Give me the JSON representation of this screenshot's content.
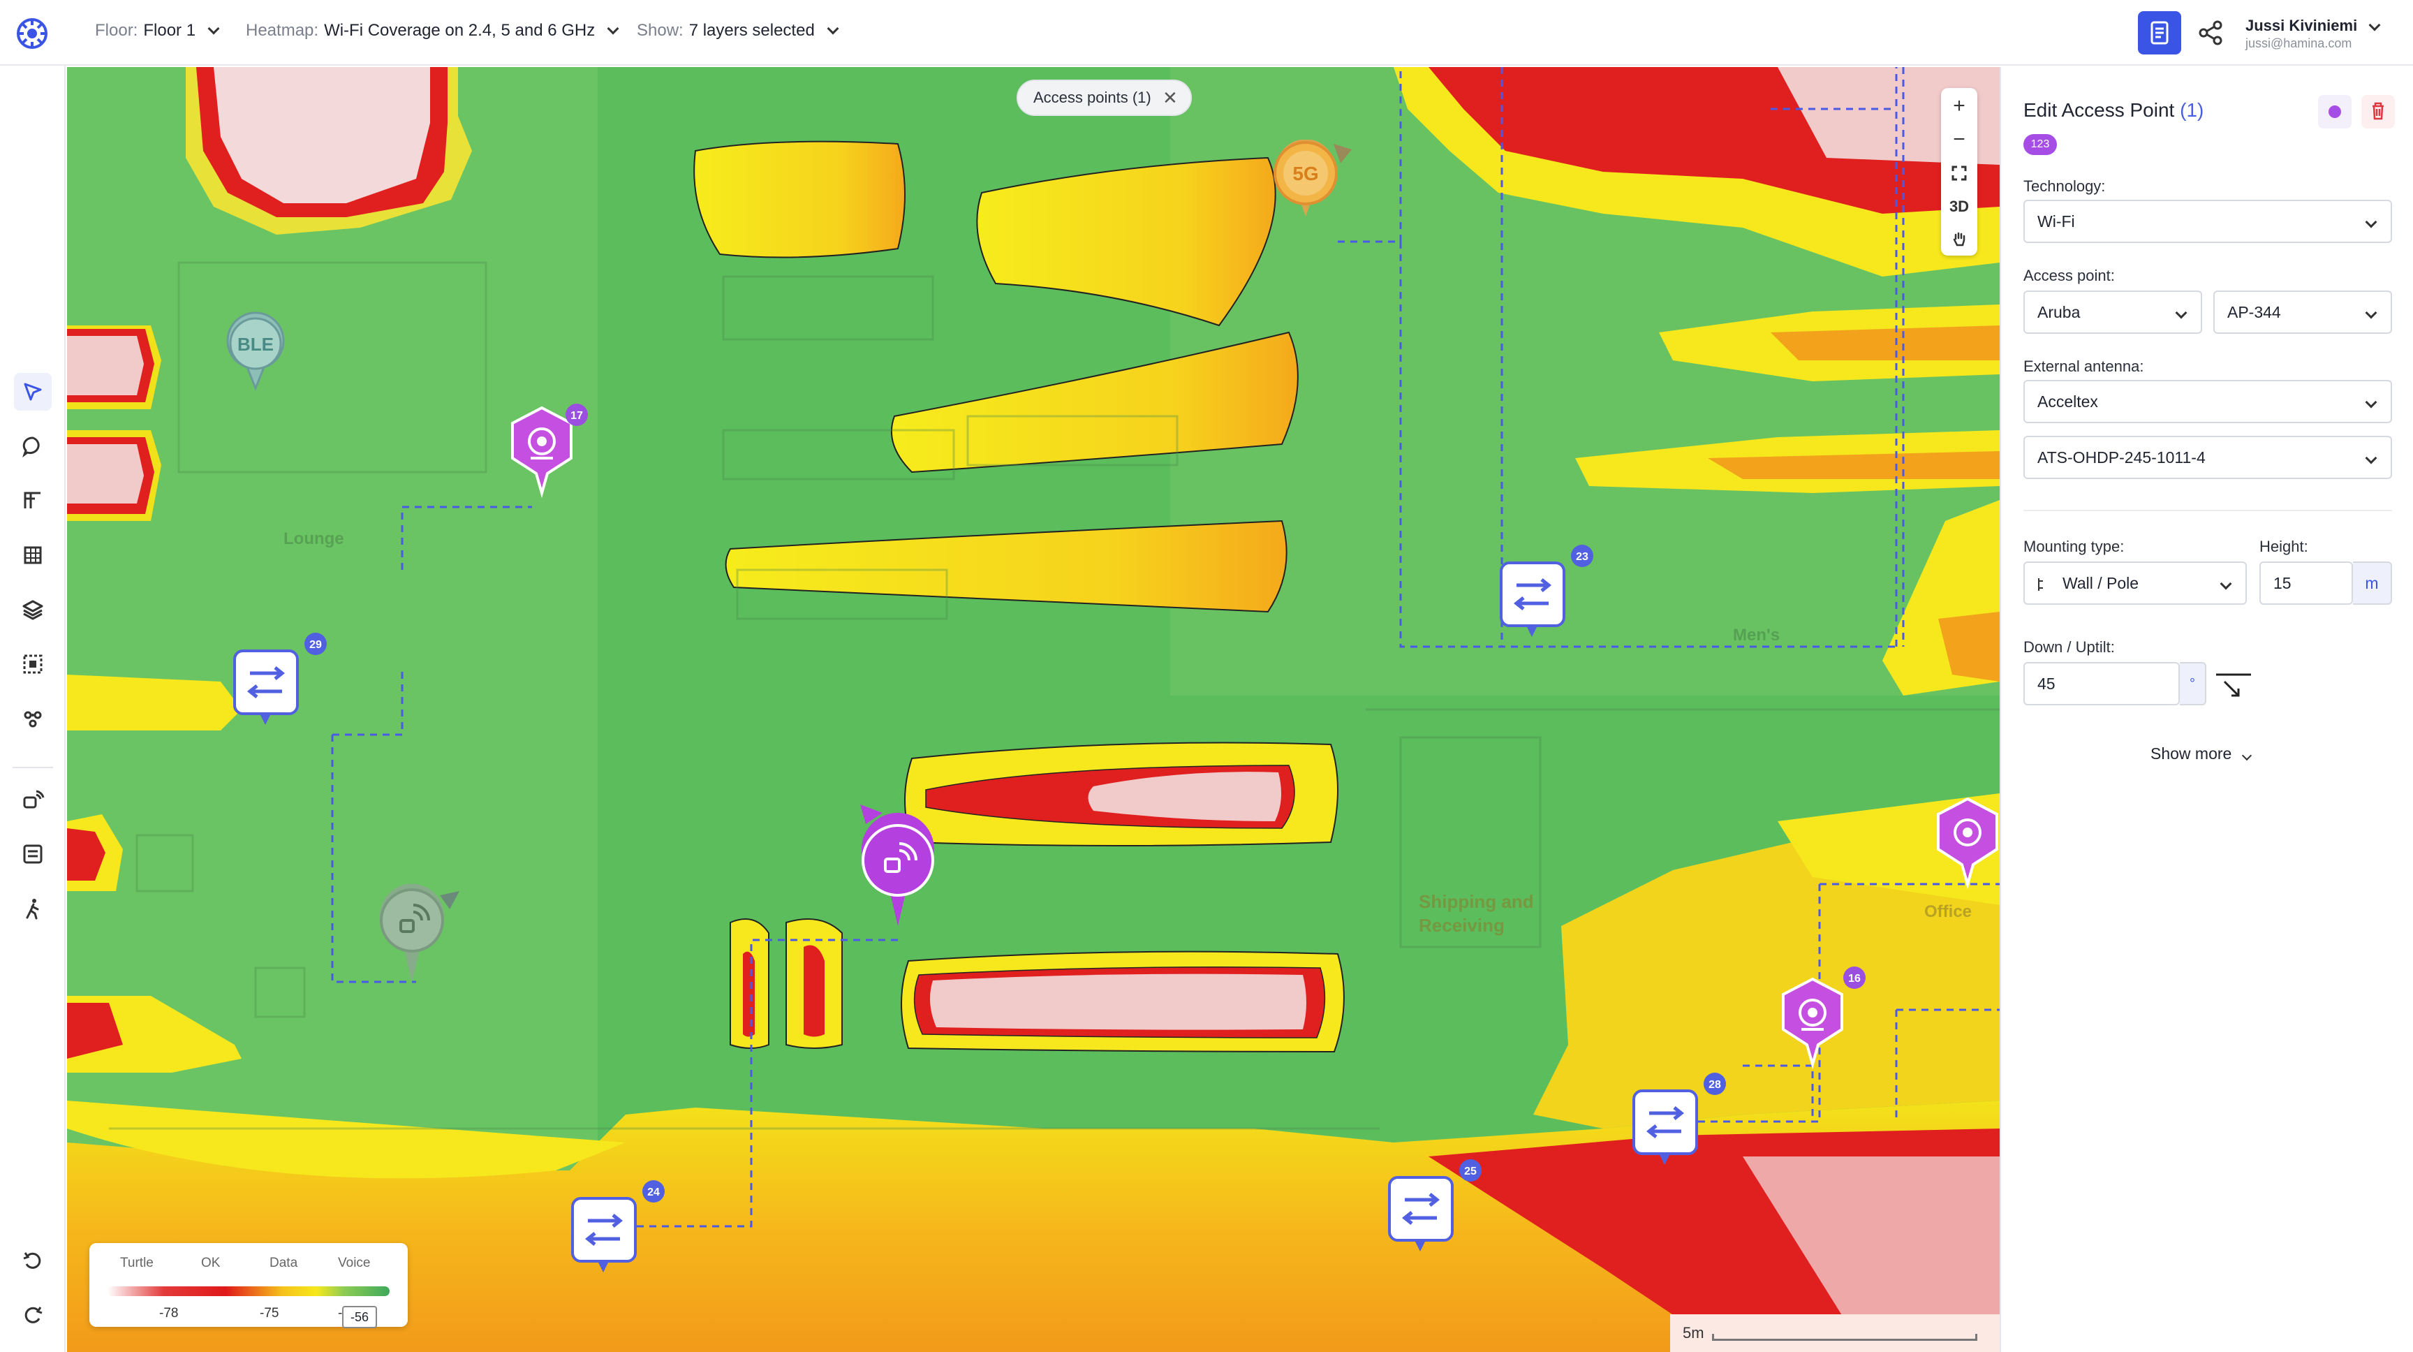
{
  "topbar": {
    "floor_label": "Floor:",
    "floor_value": "Floor 1",
    "heatmap_label": "Heatmap:",
    "heatmap_value": "Wi-Fi Coverage on 2.4, 5 and 6 GHz",
    "show_label": "Show:",
    "show_value": "7 layers selected",
    "user_name": "Jussi Kiviniemi",
    "user_email": "jussi@hamina.com"
  },
  "map": {
    "filter_chip": "Access points (1)",
    "filter_chip_close": "✕",
    "zoom_in": "+",
    "zoom_out": "−",
    "view_3d": "3D",
    "areas": {
      "lounge": "Lounge",
      "mens": "Men's",
      "shipping": "Shipping and",
      "receiving": "Receiving",
      "office": "Office"
    },
    "markers": {
      "ble": "BLE",
      "ap_5g": "5G",
      "cam_17": "17",
      "sw_23": "23",
      "sw_29": "29",
      "cam_16": "16",
      "sw_28": "28",
      "sw_25": "25",
      "sw_24": "24"
    },
    "legend": {
      "labels": [
        "Turtle",
        "OK",
        "Data",
        "Voice"
      ],
      "values": [
        "-78",
        "-75",
        "-"
      ],
      "current": "-56"
    },
    "scale_label": "5m"
  },
  "panel": {
    "title": "Edit Access Point",
    "count": "(1)",
    "badge": "123",
    "technology_label": "Technology:",
    "technology_value": "Wi-Fi",
    "access_point_label": "Access point:",
    "vendor_value": "Aruba",
    "model_value": "AP-344",
    "antenna_label": "External antenna:",
    "antenna_vendor": "Acceltex",
    "antenna_model": "ATS-OHDP-245-1011-4",
    "mounting_label": "Mounting type:",
    "mounting_value": "Wall / Pole",
    "height_label": "Height:",
    "height_value": "15",
    "height_unit": "m",
    "tilt_label": "Down / Uptilt:",
    "tilt_value": "45",
    "tilt_unit": "°",
    "show_more": "Show more"
  }
}
